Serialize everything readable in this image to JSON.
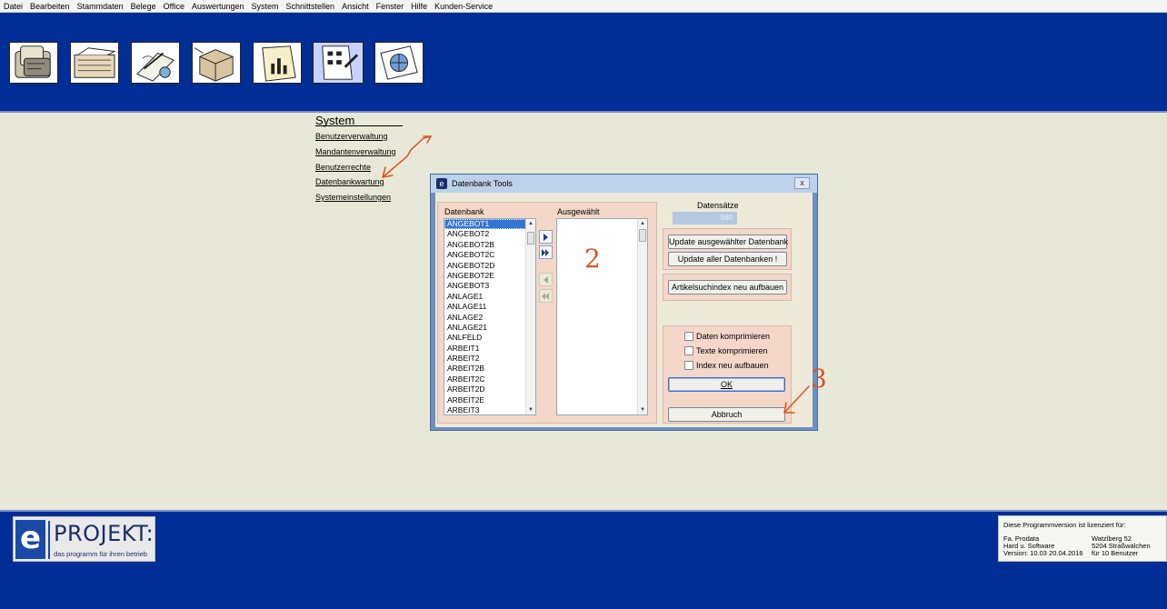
{
  "menu": [
    "Datei",
    "Bearbeiten",
    "Stammdaten",
    "Belege",
    "Office",
    "Auswertungen",
    "System",
    "Schnittstellen",
    "Ansicht",
    "Fenster",
    "Hilfe",
    "Kunden-Service"
  ],
  "toolbar_icons": [
    "contacts-icon",
    "files-icon",
    "writing-icon",
    "package-icon",
    "chart-icon",
    "system-tools-icon",
    "globe-icon"
  ],
  "system_menu": {
    "title": "System",
    "links": [
      "Benutzerverwaltung",
      "Mandantenverwaltung",
      "Benutzerrechte",
      "Datenbankwartung",
      "Systemeinstellungen"
    ]
  },
  "annotations": [
    "2",
    "3"
  ],
  "dialog": {
    "title": "Datenbank Tools",
    "close_label": "x",
    "datenbank_label": "Datenbank",
    "ausgewaehlt_label": "Ausgewählt",
    "datenbank_items": [
      "ANGEBOT1",
      "ANGEBOT2",
      "ANGEBOT2B",
      "ANGEBOT2C",
      "ANGEBOT2D",
      "ANGEBOT2E",
      "ANGEBOT3",
      "ANLAGE1",
      "ANLAGE11",
      "ANLAGE2",
      "ANLAGE21",
      "ANLFELD",
      "ARBEIT1",
      "ARBEIT2",
      "ARBEIT2B",
      "ARBEIT2C",
      "ARBEIT2D",
      "ARBEIT2E",
      "ARBEIT3"
    ],
    "selected_item": "ANGEBOT1",
    "datensaetze_label": "Datensätze",
    "datensaetze_value": "560",
    "btn_update_selected": "Update ausgewählter Datenbank",
    "btn_update_all": "Update aller Datenbanken !",
    "btn_rebuild_index": "Artikelsuchindex neu aufbauen",
    "chk_daten": "Daten komprimieren",
    "chk_texte": "Texte komprimieren",
    "chk_index": "Index neu aufbauen",
    "btn_ok": "OK",
    "btn_abbruch": "Abbruch"
  },
  "logo": {
    "letter": "e",
    "name": "PROJEKT:",
    "tagline": "das programm für ihren betrieb"
  },
  "license": {
    "heading": "Diese Programmversion ist lizenziert für:",
    "left": [
      "Fa. Prodata",
      "Hard u. Software",
      "Version: 10.03 20.04.2016"
    ],
    "right": [
      "Watzlberg 52",
      "5204 Straßwalchen",
      "für 10 Benutzer"
    ]
  },
  "colors": {
    "band_blue": "#002e96",
    "content_bg": "#e8e8d8",
    "panel_peach": "#f3d7c9",
    "selection_blue": "#3375d6",
    "annotation_orange": "#d9541f"
  }
}
